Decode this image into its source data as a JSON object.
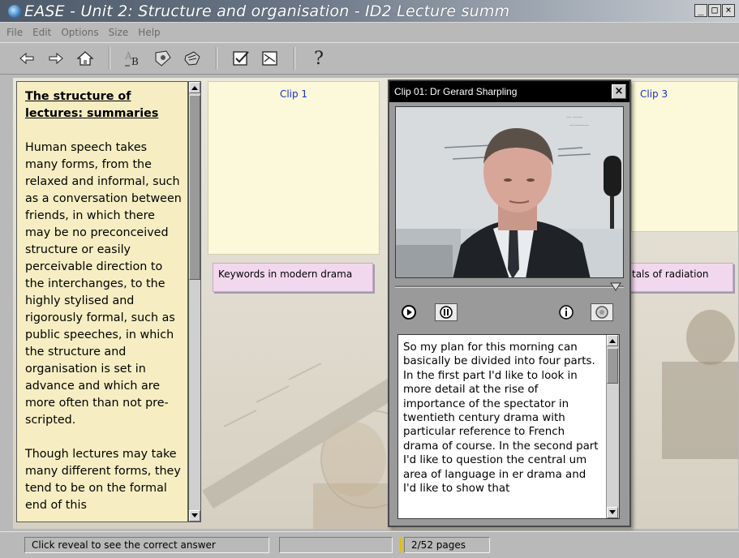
{
  "window": {
    "title": "EASE - Unit 2: Structure and organisation - ID2 Lecture summ",
    "controls": [
      "_",
      "□",
      "×"
    ]
  },
  "menu": [
    "File",
    "Edit",
    "Options",
    "Size",
    "Help"
  ],
  "toolbar": {
    "icons": [
      "back-arrow-icon",
      "forward-arrow-icon",
      "home-icon",
      "spellcheck-icon",
      "view-icon",
      "hand-icon",
      "check-icon",
      "reveal-icon",
      "help-icon"
    ],
    "help_glyph": "?"
  },
  "left_panel": {
    "title": "The structure of lectures: summaries",
    "paragraphs": [
      "Human speech takes many forms, from the relaxed and informal, such as a conversation between friends, in which there may be no preconceived structure or easily perceivable direction to the interchanges, to the highly stylised and rigorously formal, such as public speeches, in which the structure and organisation is set in advance and which are more often than not pre-scripted.",
      "Though lectures may take many different forms, they tend to be on the formal end of this"
    ]
  },
  "clips": [
    {
      "label": "Clip 1",
      "keyword": "Keywords in modern drama"
    },
    {
      "label": "Clip 3",
      "keyword": "tals of radiation"
    }
  ],
  "video_window": {
    "title": "Clip 01: Dr Gerard Sharpling",
    "close": "×",
    "transcript": "So my plan for this morning can basically be divided into four parts. In the first part I'd like to look in more detail at the rise of importance of the spectator in twentieth century drama with particular reference to French drama of course. In the second part I'd like to question the central um area of language in er drama and I'd like to show that"
  },
  "status": {
    "message": "Click reveal to see the correct answer",
    "middle": "",
    "pages": "2/52 pages"
  },
  "colors": {
    "panel_bg": "#f6eec2",
    "clip_title": "#1a2fd0",
    "keyword_bg": "#f2d8ee"
  }
}
